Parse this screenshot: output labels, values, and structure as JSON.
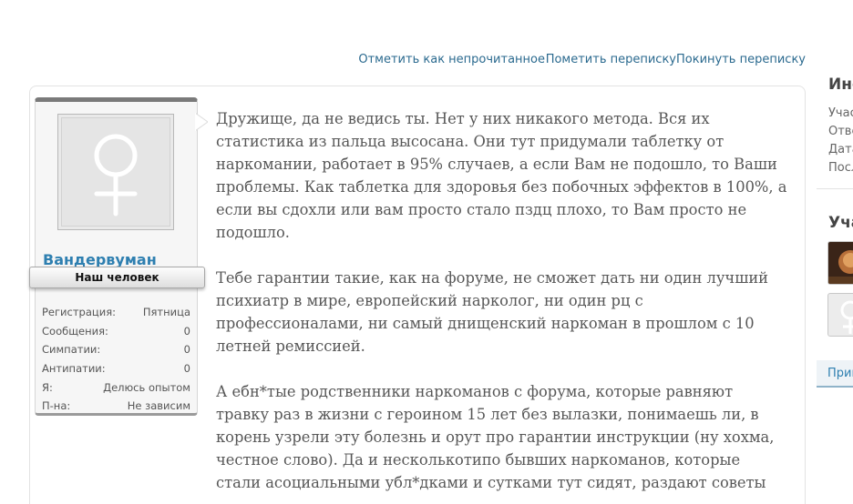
{
  "top_links": {
    "mark_unread": "Отметить как непрочитанное",
    "mark_conversation": "Пометить переписку",
    "leave_conversation": "Покинуть переписку"
  },
  "user": {
    "name": "Вандервуман",
    "rank": "Наш человек",
    "stats": [
      {
        "label": "Регистрация:",
        "value": "Пятница"
      },
      {
        "label": "Сообщения:",
        "value": "0"
      },
      {
        "label": "Симпатии:",
        "value": "0"
      },
      {
        "label": "Антипатии:",
        "value": "0"
      },
      {
        "label": "Я:",
        "value": "Делюсь опытом"
      },
      {
        "label": "П-на:",
        "value": "Не зависим"
      }
    ]
  },
  "message": {
    "paragraphs": [
      "Дружище, да не ведись ты. Нет у них никакого метода. Вся их статистика из пальца высосана. Они тут придумали таблетку от наркомании, работает в 95% случаев, а если Вам не подошло, то Ваши проблемы. Как таблетка для здоровья без побочных эффектов в 100%, а если вы сдохли или вам просто стало пздц плохо, то Вам просто не подошло.",
      "Тебе гарантии такие, как на форуме, не сможет дать ни один лучший психиатр в мире, европейский нарколог, ни один рц с профессионалами, ни самый днищенский наркоман в прошлом с 10 летней ремиссией.",
      "А ебн*тые родственники наркоманов с форума, которые равняют травку раз в жизни с героином 15 лет без вылазки, понимаешь ли, в корень узрели эту болезнь и орут про гарантии инструкции (ну хохма, честное слово). Да и несколькотипо бывших наркоманов, которые стали асоциальными убл*дками и сутками тут сидят, раздают советы"
    ]
  },
  "sidebar": {
    "info_title": "Инс",
    "info_labels": [
      "Учас",
      "Отве",
      "Дата",
      "Посл"
    ],
    "participants_title": "Уча",
    "button_label": "Приг"
  }
}
